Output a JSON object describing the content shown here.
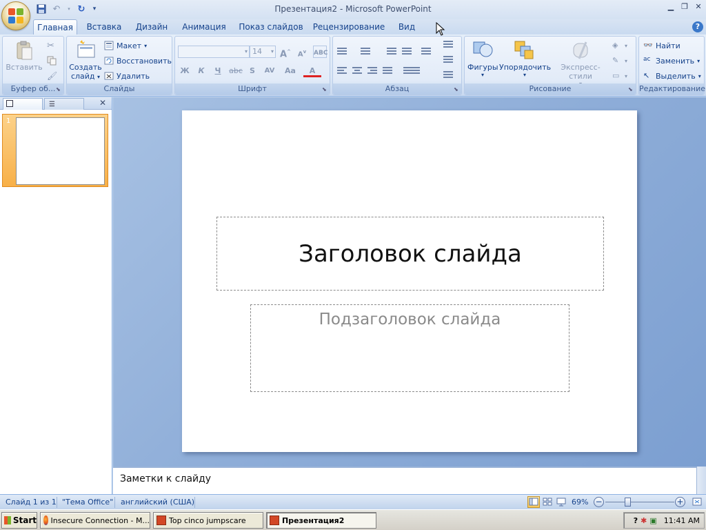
{
  "window": {
    "title": "Презентация2 - Microsoft PowerPoint"
  },
  "tabs": [
    "Главная",
    "Вставка",
    "Дизайн",
    "Анимация",
    "Показ слайдов",
    "Рецензирование",
    "Вид"
  ],
  "ribbon": {
    "clipboard": {
      "label": "Буфер об...",
      "paste": "Вставить"
    },
    "slides": {
      "label": "Слайды",
      "new_slide_line1": "Создать",
      "new_slide_line2": "слайд",
      "layout": "Макет",
      "reset": "Восстановить",
      "delete": "Удалить"
    },
    "font": {
      "label": "Шрифт",
      "font_name": "",
      "font_size": "14",
      "bold": "Ж",
      "italic": "К",
      "underline": "Ч",
      "strike": "abc",
      "shadow": "S",
      "spacing": "AV",
      "case": "Aa",
      "color": "A",
      "grow": "A",
      "shrink": "A"
    },
    "paragraph": {
      "label": "Абзац"
    },
    "drawing": {
      "label": "Рисование",
      "shapes": "Фигуры",
      "arrange": "Упорядочить",
      "quick_styles": "Экспресс-стили"
    },
    "editing": {
      "label": "Редактирование",
      "find": "Найти",
      "replace": "Заменить",
      "select": "Выделить"
    }
  },
  "left_panel": {
    "slide_number": "1"
  },
  "slide": {
    "title": "Заголовок слайда",
    "subtitle": "Подзаголовок слайда"
  },
  "notes": {
    "placeholder": "Заметки к слайду"
  },
  "status": {
    "slide_info": "Слайд 1 из 1",
    "theme": "\"Тема Office\"",
    "language": "английский (США)",
    "zoom": "69%"
  },
  "taskbar": {
    "start": "Start",
    "tasks": [
      "Insecure Connection - M...",
      "Top cinco jumpscare",
      "Презентация2"
    ],
    "clock": "11:41 AM"
  },
  "colors": {
    "accent": "#15428b",
    "ribbon_bg": "#dbe7f6",
    "workspace": "#8eadd8",
    "thumb_selected": "#f8b048"
  }
}
